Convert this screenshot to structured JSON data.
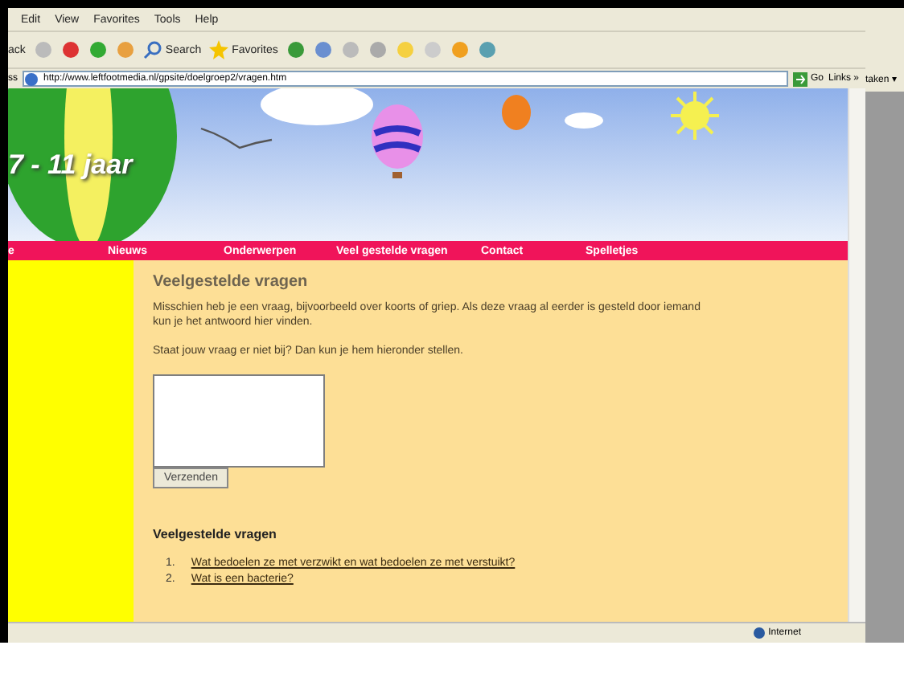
{
  "menu_bar": {
    "items": [
      "Edit",
      "View",
      "Favorites",
      "Tools",
      "Help"
    ]
  },
  "toolbar": {
    "back": "ack",
    "search": "Search",
    "favorites": "Favorites"
  },
  "address_bar": {
    "label": "ss",
    "url": "http://www.leftfootmedia.nl/gpsite/doelgroep2/vragen.htm",
    "go": "Go",
    "links": "Links »"
  },
  "side_window": {
    "label": "taken ▾"
  },
  "banner": {
    "tagline": "7 - 11 jaar"
  },
  "nav": {
    "items": [
      "e",
      "Nieuws",
      "Onderwerpen",
      "Veel gestelde vragen",
      "Contact",
      "Spelletjes"
    ]
  },
  "content": {
    "title": "Veelgestelde vragen",
    "paragraphs": [
      "Misschien heb je een vraag, bijvoorbeeld over koorts of griep. Als deze vraag al eerder is gesteld door iemand kun je het antwoord hier vinden.",
      "Staat jouw vraag er niet bij? Dan kun je hem hieronder stellen."
    ],
    "submit": "Verzenden",
    "faq_title": "Veelgestelde vragen",
    "faq": [
      {
        "number": "1.",
        "text": "Wat bedoelen ze met verzwikt en wat bedoelen ze met verstuikt?"
      },
      {
        "number": "2.",
        "text": "Wat is een bacterie?"
      }
    ]
  },
  "status_bar": {
    "zone": "Internet"
  }
}
